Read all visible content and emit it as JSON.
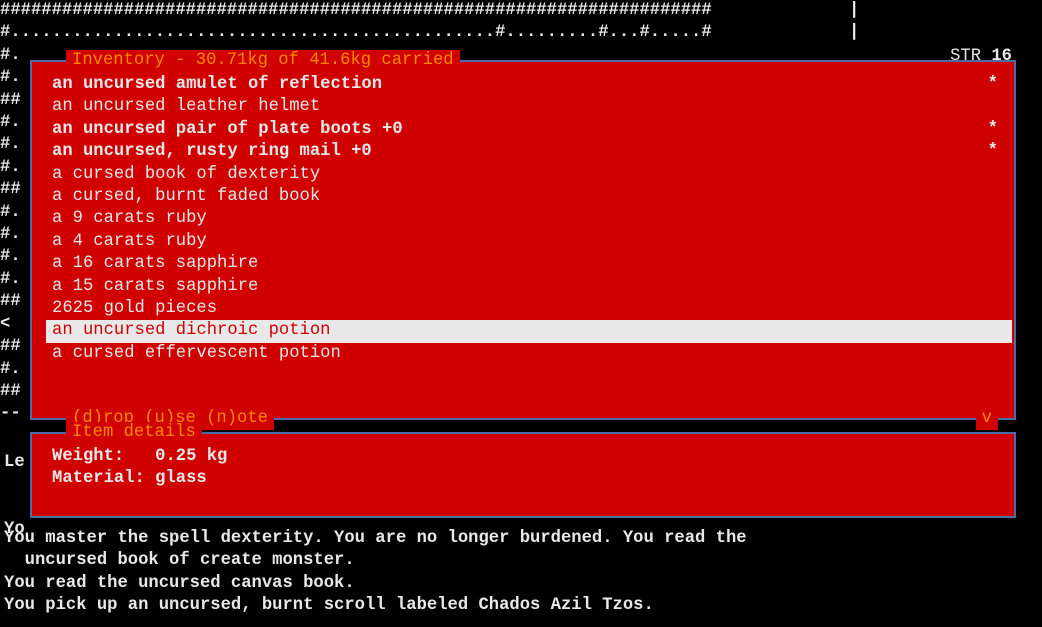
{
  "map": {
    "rows": [
      "#####################################################################",
      "#...............................................#.........#...#.....#",
      "#.",
      "#.",
      "##",
      "#.",
      "#.",
      "#.",
      "##",
      "#.",
      "#.",
      "#.",
      "#.                                                                                 .",
      "##",
      "< ",
      "##",
      "#.",
      "##",
      "--"
    ],
    "vbar": "|\n|"
  },
  "stats": {
    "str_label": "STR ",
    "str_value": "16"
  },
  "inventory": {
    "title": " Inventory - 30.71kg of 41.6kg carried ",
    "items": [
      {
        "text": "an uncursed amulet of reflection",
        "bold": true,
        "mark": "*",
        "selected": false
      },
      {
        "text": "an uncursed leather helmet",
        "bold": false,
        "mark": "",
        "selected": false
      },
      {
        "text": "an uncursed pair of plate boots +0",
        "bold": true,
        "mark": "*",
        "selected": false
      },
      {
        "text": "an uncursed, rusty ring mail +0",
        "bold": true,
        "mark": "*",
        "selected": false
      },
      {
        "text": "a cursed book of dexterity",
        "bold": false,
        "mark": "",
        "selected": false
      },
      {
        "text": "a cursed, burnt faded book",
        "bold": false,
        "mark": "",
        "selected": false
      },
      {
        "text": "a 9 carats ruby",
        "bold": false,
        "mark": "",
        "selected": false
      },
      {
        "text": "a 4 carats ruby",
        "bold": false,
        "mark": "",
        "selected": false
      },
      {
        "text": "a 16 carats sapphire",
        "bold": false,
        "mark": "",
        "selected": false
      },
      {
        "text": "a 15 carats sapphire",
        "bold": false,
        "mark": "",
        "selected": false
      },
      {
        "text": "2625 gold pieces",
        "bold": false,
        "mark": "",
        "selected": false
      },
      {
        "text": "an uncursed dichroic potion",
        "bold": false,
        "mark": "",
        "selected": true
      },
      {
        "text": "a cursed effervescent potion",
        "bold": false,
        "mark": "",
        "selected": false
      }
    ],
    "hint": " (d)rop (u)se (n)ote ",
    "scroll_indicator": " v "
  },
  "details": {
    "title": " Item details ",
    "weight_label": "Weight:   ",
    "weight_value": "0.25 kg",
    "material_label": "Material: ",
    "material_value": "glass"
  },
  "log": {
    "peek1": "Le",
    "peek2": "Yo",
    "lines": [
      "You master the spell dexterity. You are no longer burdened. You read the",
      "  uncursed book of create monster.",
      "You read the uncursed canvas book.",
      "You pick up an uncursed, burnt scroll labeled Chados Azil Tzos."
    ]
  }
}
